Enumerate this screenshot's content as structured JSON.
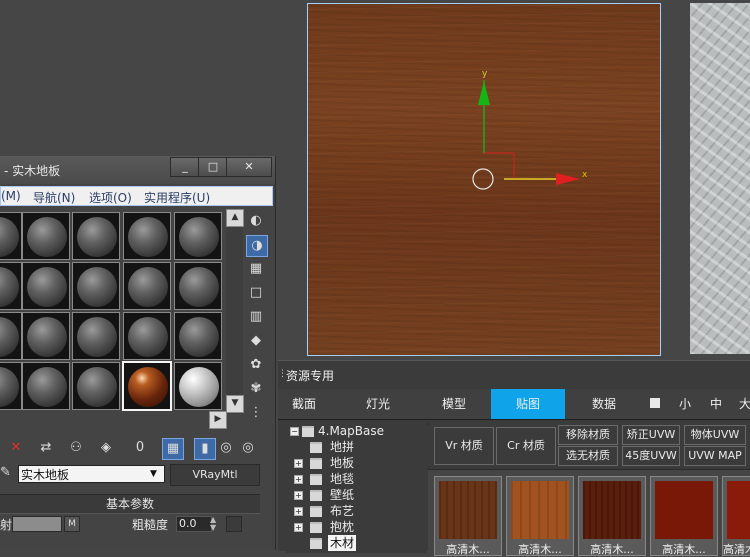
{
  "material_editor": {
    "title": "- 实木地板",
    "window_buttons": [
      "_",
      "□",
      "✕"
    ],
    "menu": [
      "(M)",
      "导航(N)",
      "选项(O)",
      "实用程序(U)"
    ],
    "material_name": "实木地板",
    "material_type": "VRayMtl",
    "rollout_title": "基本参数",
    "diffuse_label": "射",
    "m_button": "M",
    "roughness_label": "粗糙度",
    "roughness_value": "0.0"
  },
  "resource_panel": {
    "title": "资源专用",
    "tabs": [
      "截面",
      "灯光",
      "模型",
      "贴图",
      "数据"
    ],
    "active_tab": "贴图",
    "size_options": [
      "小",
      "中",
      "大"
    ],
    "tree": {
      "root": "4.MapBase",
      "items": [
        "地拼",
        "地板",
        "地毯",
        "壁纸",
        "布艺",
        "抱枕",
        "木材"
      ],
      "selected": "木材"
    },
    "buttons": {
      "vr_material": "Vr 材质",
      "cr_material": "Cr 材质",
      "remove_material": "移除材质",
      "correct_uvw": "矫正UVW",
      "object_uvw": "物体UVW",
      "select_no_material": "选无材质",
      "uvw_45": "45度UVW",
      "uvw_map": "UVW MAP"
    },
    "thumbnails": [
      {
        "label": "高清木...",
        "color": "#6a3418"
      },
      {
        "label": "高清木...",
        "color": "#a1521f"
      },
      {
        "label": "高清木...",
        "color": "#5c1e0c"
      },
      {
        "label": "高清木...",
        "color": "#7a1808"
      },
      {
        "label": "高清木...",
        "color": "#8a1a0a"
      }
    ]
  },
  "viewport": {
    "axis_x": "x",
    "axis_y": "y"
  }
}
